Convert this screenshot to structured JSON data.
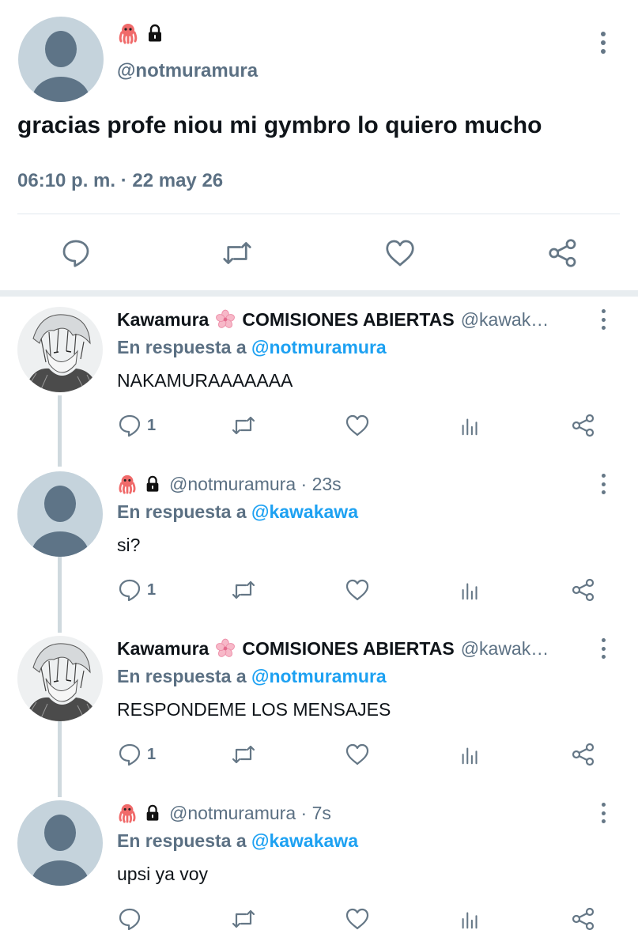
{
  "main_tweet": {
    "name_icons": [
      "octopus-icon",
      "lock-icon"
    ],
    "handle": "@notmuramura",
    "text": "gracias profe niou mi gymbro lo quiero mucho",
    "meta": "06:10 p. m. · 22 may 26",
    "actions": [
      "reply-icon",
      "retweet-icon",
      "like-icon",
      "share-icon"
    ]
  },
  "replies": [
    {
      "name": "Kawamura",
      "name_emoji": "cherry-blossom-icon",
      "name_suffix": "COMISIONES ABIERTAS",
      "handle": "@kawak…",
      "in_reply_prefix": "En respuesta a",
      "in_reply_mention": "@notmuramura",
      "text": "NAKAMURAAAAAAA",
      "reply_count": "1"
    },
    {
      "handle_time": "@notmuramura · 23s",
      "in_reply_prefix": "En respuesta a",
      "in_reply_mention": "@kawakawa",
      "text": "si?",
      "reply_count": "1"
    },
    {
      "name": "Kawamura",
      "name_emoji": "cherry-blossom-icon",
      "name_suffix": "COMISIONES ABIERTAS",
      "handle": "@kawak…",
      "in_reply_prefix": "En respuesta a",
      "in_reply_mention": "@notmuramura",
      "text": "RESPONDEME LOS MENSAJES",
      "reply_count": "1"
    },
    {
      "handle_time": "@notmuramura · 7s",
      "in_reply_prefix": "En respuesta a",
      "in_reply_mention": "@kawakawa",
      "text": "upsi ya voy",
      "reply_count": ""
    }
  ],
  "colors": {
    "text": "#0f1419",
    "secondary": "#5b7083",
    "mention": "#1da1f2",
    "thread_line": "#cfd9de",
    "divider": "#e1e8ed",
    "octopus": "#f06a6a"
  }
}
